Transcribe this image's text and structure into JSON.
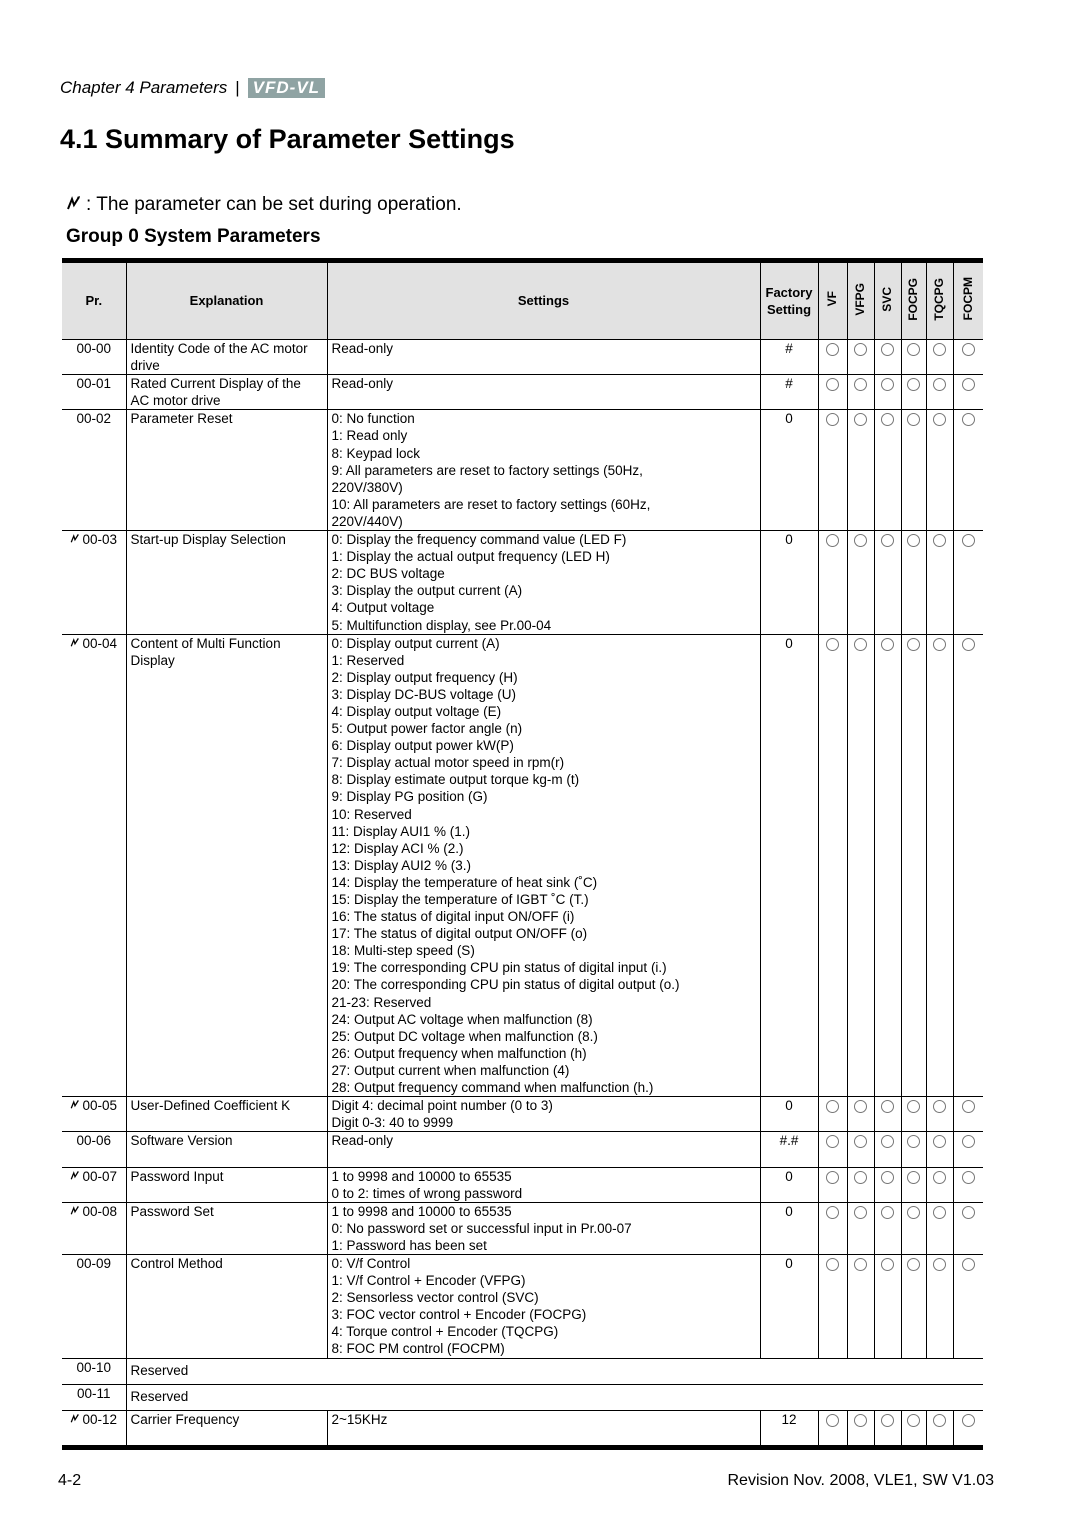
{
  "header": {
    "chapter": "Chapter 4 Parameters",
    "separator": "|",
    "logo": "VFD-VL"
  },
  "title": "4.1 Summary of Parameter Settings",
  "note": {
    "icon": "run-setting-icon",
    "symbol": "Ȿ",
    "text": ": The parameter can be set during operation."
  },
  "group_title": "Group 0 System Parameters",
  "table": {
    "columns": {
      "pr": "Pr.",
      "explanation": "Explanation",
      "settings": "Settings",
      "factory": "Factory Setting",
      "modes": [
        "VF",
        "VFPG",
        "SVC",
        "FOCPG",
        "TQCPG",
        "FOCPM"
      ]
    },
    "mode_symbol": "circle",
    "rows": [
      {
        "pr": "00-00",
        "run": false,
        "explanation": "Identity Code of the AC motor drive",
        "settings": [
          "Read-only"
        ],
        "factory": "#",
        "modes": [
          true,
          true,
          true,
          true,
          true,
          true
        ]
      },
      {
        "pr": "00-01",
        "run": false,
        "explanation": "Rated Current Display of the AC motor drive",
        "settings": [
          "Read-only"
        ],
        "factory": "#",
        "modes": [
          true,
          true,
          true,
          true,
          true,
          true
        ]
      },
      {
        "pr": "00-02",
        "run": false,
        "explanation": "Parameter Reset",
        "settings": [
          "0: No function",
          "1: Read only",
          "8: Keypad lock",
          "9: All parameters are reset to factory settings (50Hz,",
          "220V/380V)",
          "10: All parameters are reset to factory settings (60Hz,",
          "220V/440V)"
        ],
        "factory": "0",
        "modes": [
          true,
          true,
          true,
          true,
          true,
          true
        ]
      },
      {
        "pr": "00-03",
        "run": true,
        "explanation": "Start-up Display Selection",
        "settings": [
          "0: Display the frequency command value (LED F)",
          "1: Display the actual output frequency (LED H)",
          "2: DC BUS voltage",
          "3: Display the output current (A)",
          "4: Output voltage",
          "5: Multifunction display, see Pr.00-04"
        ],
        "factory": "0",
        "modes": [
          true,
          true,
          true,
          true,
          true,
          true
        ]
      },
      {
        "pr": "00-04",
        "run": true,
        "explanation": "Content of Multi Function Display",
        "settings": [
          "0: Display output current (A)",
          "1: Reserved",
          "2: Display output frequency (H)",
          "3: Display DC-BUS voltage (U)",
          "4: Display output voltage (E)",
          "5: Output power factor angle (n)",
          "6: Display output power kW(P)",
          "7: Display actual motor speed in rpm(r)",
          "8: Display estimate output torque kg-m (t)",
          "9: Display PG position (G)",
          "10: Reserved",
          "11: Display AUI1 % (1.)",
          "12: Display ACI % (2.)",
          "13: Display AUI2 % (3.)",
          "14: Display the temperature of heat sink (˚C)",
          "15: Display the temperature of IGBT ˚C (T.)",
          "16: The status of digital input ON/OFF (i)",
          "17: The status of digital output ON/OFF (o)",
          "18: Multi-step speed (S)",
          "19: The corresponding CPU pin status of digital input (i.)",
          "20: The corresponding CPU pin status of digital output (o.)",
          "21-23: Reserved",
          "24: Output AC voltage when malfunction (8)",
          "25: Output DC voltage when malfunction (8.)",
          "26: Output frequency when malfunction (h)",
          "27: Output current when malfunction (4)",
          "28: Output frequency command when malfunction (h.)"
        ],
        "factory": "0",
        "modes": [
          true,
          true,
          true,
          true,
          true,
          true
        ]
      },
      {
        "pr": "00-05",
        "run": true,
        "explanation": "User-Defined Coefficient K",
        "settings": [
          "Digit 4: decimal point number (0 to 3)",
          "Digit 0-3: 40 to 9999"
        ],
        "factory": "0",
        "modes": [
          true,
          true,
          true,
          true,
          true,
          true
        ]
      },
      {
        "pr": "00-06",
        "run": false,
        "explanation": "Software Version",
        "settings": [
          "Read-only"
        ],
        "factory": "#.#",
        "modes": [
          true,
          true,
          true,
          true,
          true,
          true
        ]
      },
      {
        "pr": "00-07",
        "run": true,
        "explanation": "Password Input",
        "settings": [
          "1 to 9998 and 10000 to 65535",
          "0 to 2: times of wrong password"
        ],
        "factory": "0",
        "modes": [
          true,
          true,
          true,
          true,
          true,
          true
        ]
      },
      {
        "pr": "00-08",
        "run": true,
        "explanation": "Password Set",
        "settings": [
          "1 to 9998 and 10000 to 65535",
          "0: No password set or successful input in Pr.00-07",
          "1: Password has been set"
        ],
        "factory": "0",
        "modes": [
          true,
          true,
          true,
          true,
          true,
          true
        ]
      },
      {
        "pr": "00-09",
        "run": false,
        "explanation": "Control Method",
        "settings": [
          "0: V/f Control",
          "1: V/f Control + Encoder (VFPG)",
          "2: Sensorless vector control (SVC)",
          "3: FOC vector control + Encoder  (FOCPG)",
          "4: Torque control + Encoder (TQCPG)",
          "8: FOC PM control (FOCPM)"
        ],
        "factory": "0",
        "modes": [
          true,
          true,
          true,
          true,
          true,
          true
        ]
      },
      {
        "pr": "00-10",
        "run": false,
        "explanation": "Reserved",
        "reserved": true
      },
      {
        "pr": "00-11",
        "run": false,
        "explanation": "Reserved",
        "reserved": true
      },
      {
        "pr": "00-12",
        "run": true,
        "explanation": "Carrier Frequency",
        "settings": [
          "2~15KHz"
        ],
        "factory": "12",
        "modes": [
          true,
          true,
          true,
          true,
          true,
          true
        ]
      }
    ]
  },
  "footer": {
    "page": "4-2",
    "revision": "Revision Nov. 2008, VLE1, SW V1.03"
  }
}
